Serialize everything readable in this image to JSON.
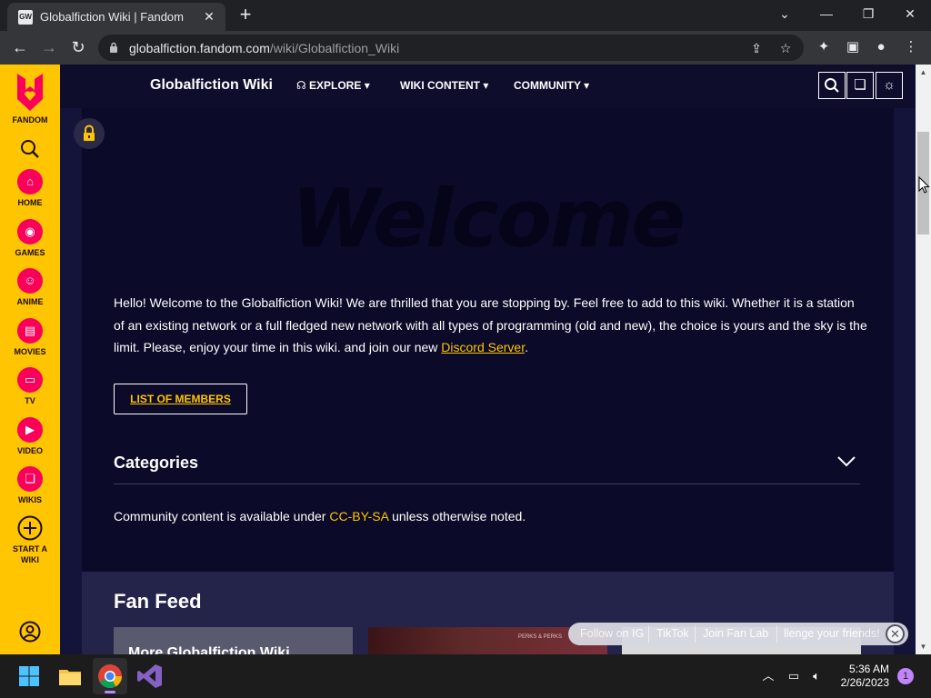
{
  "browser": {
    "tab_title": "Globalfiction Wiki | Fandom",
    "tab_favicon": "GW",
    "url_host": "globalfiction.fandom.com",
    "url_path": "/wiki/Globalfiction_Wiki"
  },
  "rail": {
    "brand": "FANDOM",
    "items": [
      {
        "label": "HOME",
        "icon": "home-icon"
      },
      {
        "label": "GAMES",
        "icon": "gamepad-icon"
      },
      {
        "label": "ANIME",
        "icon": "anime-icon"
      },
      {
        "label": "MOVIES",
        "icon": "movies-icon"
      },
      {
        "label": "TV",
        "icon": "tv-icon"
      },
      {
        "label": "VIDEO",
        "icon": "video-icon"
      },
      {
        "label": "WIKIS",
        "icon": "wikis-icon"
      }
    ],
    "start_wiki_line1": "START A",
    "start_wiki_line2": "WIKI"
  },
  "wiki_header": {
    "title": "Globalfiction Wiki",
    "nav": [
      "EXPLORE",
      "WIKI CONTENT",
      "COMMUNITY"
    ]
  },
  "main": {
    "welcome": "Welcome",
    "intro_text": "Hello! Welcome to the Globalfiction Wiki! We are thrilled that you are stopping by. Feel free to add to this wiki. Whether it is a station of an existing network or a full fledged new network with all types of programming (old and new), the choice is yours and the sky is the limit. Please, enjoy your time in this wiki. and join our new ",
    "intro_link": "Discord Server",
    "intro_end": ".",
    "members_button": "LIST OF MEMBERS",
    "categories_title": "Categories",
    "license_pre": "Community content is available under ",
    "license_link": "CC-BY-SA",
    "license_post": " unless otherwise noted."
  },
  "fan_feed": {
    "title": "Fan Feed",
    "card1_title": "More Globalfiction Wiki",
    "card2_caption": "PERKS & PERKS"
  },
  "social_pill": {
    "items": [
      "Follow on IG",
      "TikTok",
      "Join Fan Lab",
      "llenge your friends!"
    ]
  },
  "taskbar": {
    "time": "5:36 AM",
    "date": "2/26/2023",
    "notifications": "1"
  },
  "colors": {
    "fandom_yellow": "#ffc500",
    "fandom_pink": "#fa005a",
    "page_bg": "#14133a",
    "link": "#ffc500"
  }
}
